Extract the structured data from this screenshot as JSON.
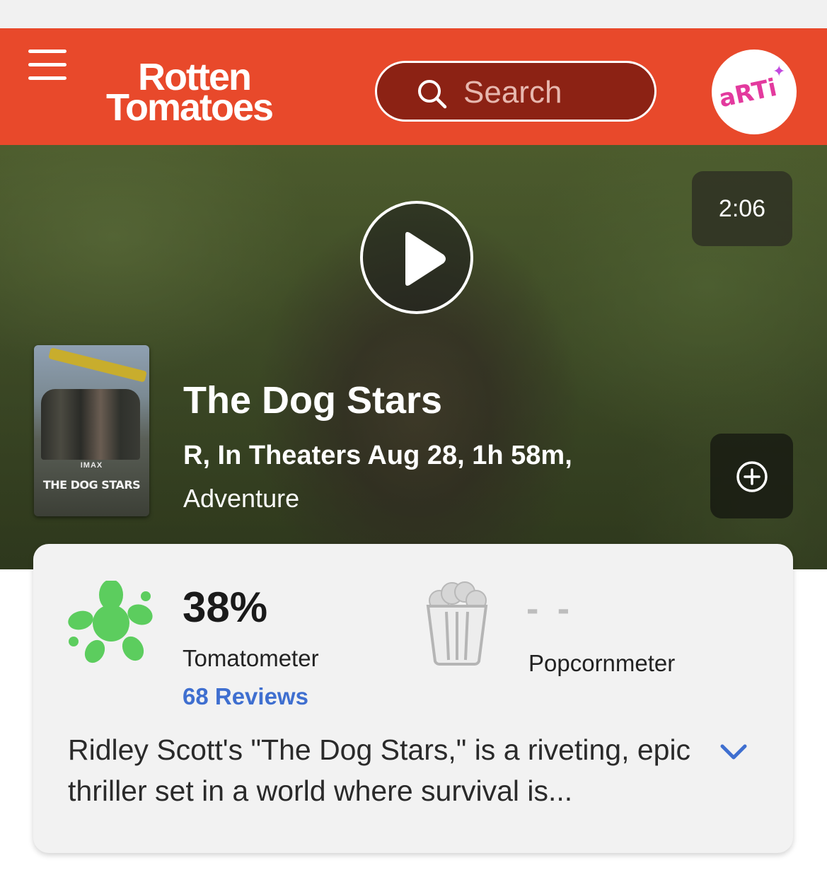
{
  "header": {
    "logo_line1": "Rotten",
    "logo_line2": "Tomatoes",
    "search_placeholder": "Search",
    "avatar_text": "aRTi",
    "brand_color": "#e8492b"
  },
  "hero": {
    "duration": "2:06",
    "poster": {
      "imax": "IMAX",
      "title": "THE DOG STARS"
    },
    "title": "The Dog Stars",
    "meta": "R, In Theaters Aug 28, 1h 58m,",
    "genre": "Adventure"
  },
  "scores": {
    "tomatometer_value": "38%",
    "tomatometer_label": "Tomatometer",
    "reviews_link": "68 Reviews",
    "popcornmeter_value": "- -",
    "popcornmeter_label": "Popcornmeter"
  },
  "consensus": {
    "text": "Ridley Scott's \"The Dog Stars,\" is a riveting, epic thriller set in a world where survival is..."
  }
}
